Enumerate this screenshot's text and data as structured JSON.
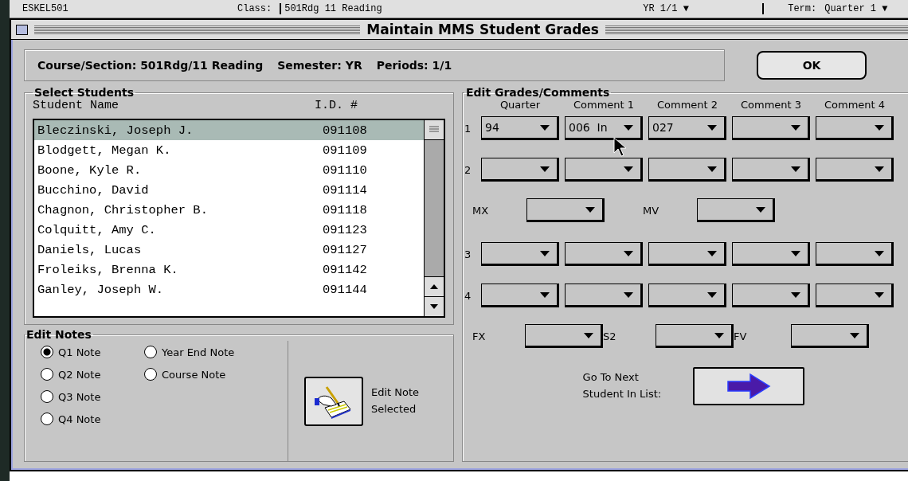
{
  "background_window": {
    "items": [
      {
        "kind": "text",
        "text": "ESKEL501"
      },
      {
        "kind": "label",
        "text": "Class:"
      },
      {
        "kind": "field",
        "text": "501Rdg   11   Reading"
      },
      {
        "kind": "dropdown",
        "text": "YR  1/1 ▼"
      },
      {
        "kind": "label",
        "text": "Term:"
      },
      {
        "kind": "dropdown",
        "text": "Quarter 1 ▼"
      }
    ]
  },
  "window": {
    "title": "Maintain MMS Student Grades"
  },
  "header": {
    "items": [
      "Course/Section: 501Rdg/11 Reading",
      "Semester: YR",
      "Periods: 1/1"
    ],
    "ok_button": "OK"
  },
  "select_students": {
    "title": "Select Students",
    "columns": [
      "Student Name",
      "I.D. #"
    ],
    "rows": [
      {
        "name": "Bleczinski, Joseph J.",
        "id": "091108",
        "selected": true
      },
      {
        "name": "Blodgett, Megan K.",
        "id": "091109",
        "selected": false
      },
      {
        "name": "Boone, Kyle R.",
        "id": "091110",
        "selected": false
      },
      {
        "name": "Bucchino, David",
        "id": "091114",
        "selected": false
      },
      {
        "name": "Chagnon, Christopher B.",
        "id": "091118",
        "selected": false
      },
      {
        "name": "Colquitt, Amy C.",
        "id": "091123",
        "selected": false
      },
      {
        "name": "Daniels, Lucas",
        "id": "091127",
        "selected": false
      },
      {
        "name": "Froleiks, Brenna K.",
        "id": "091142",
        "selected": false
      },
      {
        "name": "Ganley, Joseph W.",
        "id": "091144",
        "selected": false
      }
    ]
  },
  "edit_notes": {
    "title": "Edit Notes",
    "options": [
      {
        "label": "Q1 Note",
        "selected": true
      },
      {
        "label": "Q2 Note",
        "selected": false
      },
      {
        "label": "Q3 Note",
        "selected": false
      },
      {
        "label": "Q4 Note",
        "selected": false
      },
      {
        "label": "Year End Note",
        "selected": false
      },
      {
        "label": "Course Note",
        "selected": false
      }
    ],
    "edit_button_label": "Edit Note Selected"
  },
  "edit_grades": {
    "title": "Edit Grades/Comments",
    "columns": [
      "Quarter",
      "Comment 1",
      "Comment 2",
      "Comment 3",
      "Comment 4"
    ],
    "sections": [
      {
        "kind": "quarter",
        "label": "1",
        "dropdowns": [
          {
            "kind": "dropdown",
            "value": "94"
          },
          {
            "kind": "dropdown",
            "value": "006  In"
          },
          {
            "kind": "dropdown",
            "value": "027"
          },
          {
            "kind": "dropdown"
          },
          {
            "kind": "dropdown"
          }
        ]
      },
      {
        "kind": "quarter",
        "label": "2",
        "dropdowns": [
          {
            "kind": "dropdown"
          },
          {
            "kind": "dropdown"
          },
          {
            "kind": "dropdown"
          },
          {
            "kind": "dropdown"
          },
          {
            "kind": "dropdown"
          }
        ]
      },
      {
        "kind": "pair",
        "fields": [
          {
            "label": "MX"
          },
          {
            "label": "MV"
          }
        ]
      },
      {
        "kind": "quarter",
        "label": "3",
        "dropdowns": [
          {
            "kind": "dropdown"
          },
          {
            "kind": "dropdown"
          },
          {
            "kind": "dropdown"
          },
          {
            "kind": "dropdown"
          },
          {
            "kind": "dropdown"
          }
        ]
      },
      {
        "kind": "quarter",
        "label": "4",
        "dropdowns": [
          {
            "kind": "dropdown"
          },
          {
            "kind": "dropdown"
          },
          {
            "kind": "dropdown"
          },
          {
            "kind": "dropdown"
          },
          {
            "kind": "dropdown"
          }
        ]
      },
      {
        "kind": "pair",
        "fields": [
          {
            "label": "FX"
          },
          {
            "label": "S2"
          },
          {
            "label": "FV"
          }
        ]
      }
    ],
    "next_label": "Go To Next Student In List:"
  }
}
